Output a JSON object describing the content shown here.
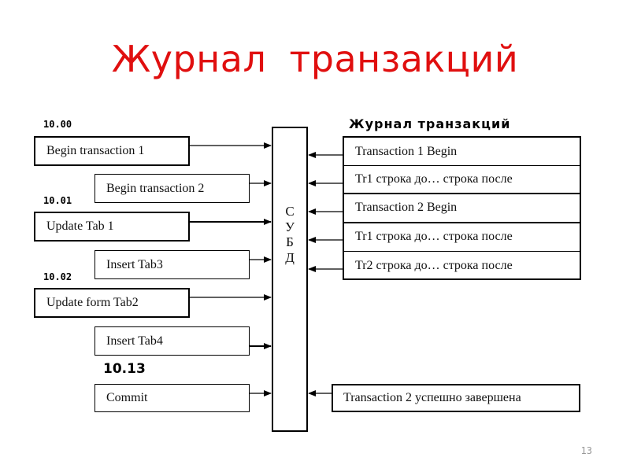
{
  "slide": {
    "title": "Журнал  транзакций",
    "page_number": "13"
  },
  "times": {
    "t1": "10.00",
    "t2": "10.01",
    "t3": "10.02",
    "t4": "10.13"
  },
  "operations": [
    {
      "label": "Begin transaction 1"
    },
    {
      "label": "Begin transaction 2"
    },
    {
      "label": "Update Tab 1"
    },
    {
      "label": "Insert Tab3"
    },
    {
      "label": "Update form Tab2"
    },
    {
      "label": "Insert Tab4"
    },
    {
      "label": "Commit"
    }
  ],
  "dbms": {
    "letters": [
      "С",
      "У",
      "Б",
      "Д"
    ]
  },
  "log": {
    "title": "Журнал транзакций",
    "rows": [
      {
        "label": "Transaction 1 Begin"
      },
      {
        "label": "Tr1 строка до… строка после"
      },
      {
        "label": "Transaction 2 Begin"
      },
      {
        "label": "Tr1 строка до… строка после"
      },
      {
        "label": "Tr2 строка до… строка после"
      }
    ],
    "final": "Transaction 2 успешно завершена"
  }
}
